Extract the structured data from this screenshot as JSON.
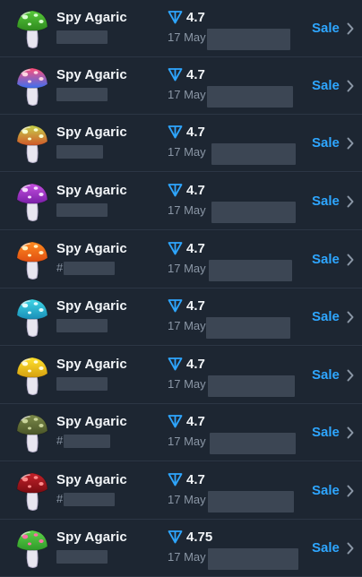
{
  "items": [
    {
      "name": "Spy Agaric",
      "sub": "",
      "price": "4.7",
      "date": "17 May",
      "action": "Sale",
      "colors": {
        "cap": "#57c93a",
        "cap_dark": "#2f8a1f",
        "spots": "#d9ffd0"
      }
    },
    {
      "name": "Spy Agaric",
      "sub": "",
      "price": "4.7",
      "date": "17 May",
      "action": "Sale",
      "colors": {
        "cap": "#ff4f7a",
        "cap_dark": "#3d6ff0",
        "spots": "#ffd6e2"
      }
    },
    {
      "name": "Spy Agaric",
      "sub": "",
      "price": "4.7",
      "date": "17 May",
      "action": "Sale",
      "colors": {
        "cap": "#c6d24a",
        "cap_dark": "#d0582a",
        "spots": "#f7ffd0"
      }
    },
    {
      "name": "Spy Agaric",
      "sub": "",
      "price": "4.7",
      "date": "17 May",
      "action": "Sale",
      "colors": {
        "cap": "#c54fe0",
        "cap_dark": "#7a1fa8",
        "spots": "#f6dcff"
      }
    },
    {
      "name": "Spy Agaric",
      "sub": "#",
      "price": "4.7",
      "date": "17 May",
      "action": "Sale",
      "colors": {
        "cap": "#ff8a1f",
        "cap_dark": "#e04f12",
        "spots": "#fff0c0"
      }
    },
    {
      "name": "Spy Agaric",
      "sub": "",
      "price": "4.7",
      "date": "17 May",
      "action": "Sale",
      "colors": {
        "cap": "#3fd6e6",
        "cap_dark": "#1a8fb8",
        "spots": "#e0fcff"
      }
    },
    {
      "name": "Spy Agaric",
      "sub": "",
      "price": "4.7",
      "date": "17 May",
      "action": "Sale",
      "colors": {
        "cap": "#ffe22e",
        "cap_dark": "#d6a010",
        "spots": "#fffbd8"
      }
    },
    {
      "name": "Spy Agaric",
      "sub": "#",
      "price": "4.7",
      "date": "17 May",
      "action": "Sale",
      "colors": {
        "cap": "#7c8a4a",
        "cap_dark": "#4a5528",
        "spots": "#c9d49a"
      }
    },
    {
      "name": "Spy Agaric",
      "sub": "#",
      "price": "4.7",
      "date": "17 May",
      "action": "Sale",
      "colors": {
        "cap": "#c4222a",
        "cap_dark": "#7a0c12",
        "spots": "#ff8a8a"
      }
    },
    {
      "name": "Spy Agaric",
      "sub": "",
      "price": "4.75",
      "date": "17 May",
      "action": "Sale",
      "colors": {
        "cap": "#5fd44a",
        "cap_dark": "#2f9a2a",
        "spots": "#ff6fa8"
      }
    }
  ],
  "accent": "#2ea6ff"
}
